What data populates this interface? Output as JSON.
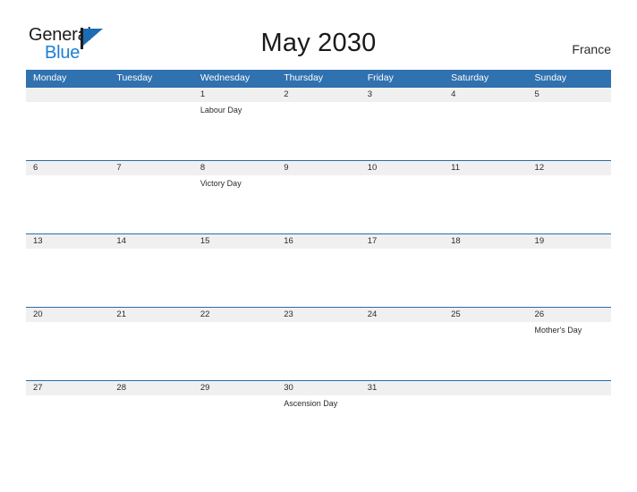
{
  "brand": {
    "word_one": "General",
    "word_two": "Blue",
    "flag_icon": "flag-triangle-icon",
    "accent_color": "#1b7fd4"
  },
  "header": {
    "title": "May 2030",
    "country": "France"
  },
  "theme": {
    "header_blue": "#3071b0",
    "rule_blue": "#2c6ca8",
    "date_band": "#f0f0f0",
    "text": "#2b2b2b"
  },
  "calendar": {
    "day_names": [
      "Monday",
      "Tuesday",
      "Wednesday",
      "Thursday",
      "Friday",
      "Saturday",
      "Sunday"
    ],
    "weeks": [
      {
        "dates": [
          "",
          "",
          "1",
          "2",
          "3",
          "4",
          "5"
        ],
        "events": [
          "",
          "",
          "Labour Day",
          "",
          "",
          "",
          ""
        ]
      },
      {
        "dates": [
          "6",
          "7",
          "8",
          "9",
          "10",
          "11",
          "12"
        ],
        "events": [
          "",
          "",
          "Victory Day",
          "",
          "",
          "",
          ""
        ]
      },
      {
        "dates": [
          "13",
          "14",
          "15",
          "16",
          "17",
          "18",
          "19"
        ],
        "events": [
          "",
          "",
          "",
          "",
          "",
          "",
          ""
        ]
      },
      {
        "dates": [
          "20",
          "21",
          "22",
          "23",
          "24",
          "25",
          "26"
        ],
        "events": [
          "",
          "",
          "",
          "",
          "",
          "",
          "Mother's Day"
        ]
      },
      {
        "dates": [
          "27",
          "28",
          "29",
          "30",
          "31",
          "",
          ""
        ],
        "events": [
          "",
          "",
          "",
          "Ascension Day",
          "",
          "",
          ""
        ]
      }
    ]
  }
}
